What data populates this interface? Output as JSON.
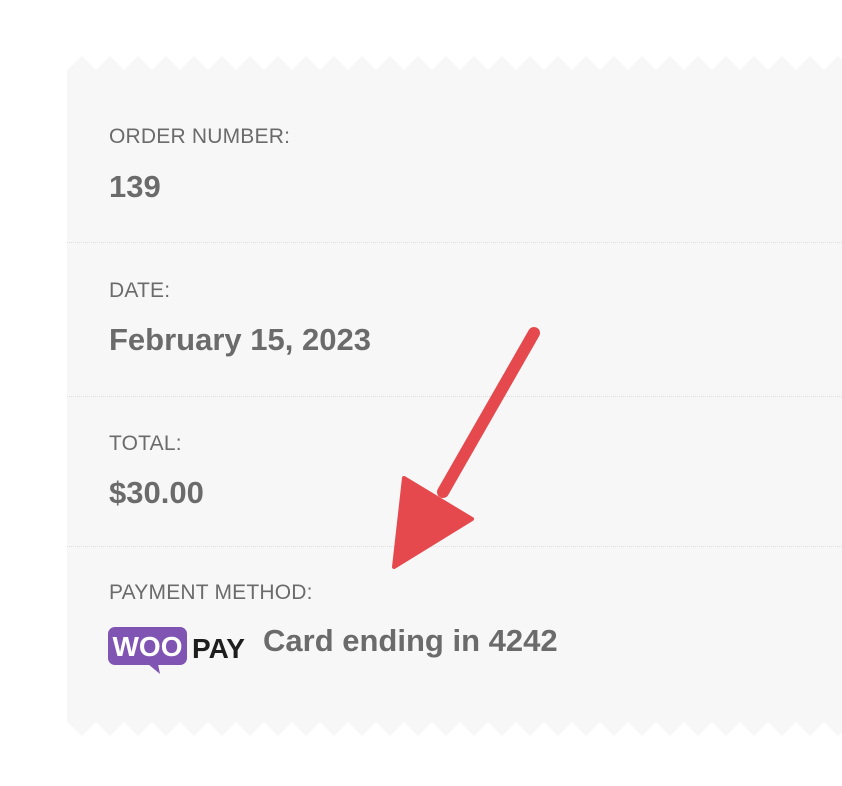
{
  "order_details": {
    "order_number": {
      "label": "ORDER NUMBER:",
      "value": "139"
    },
    "date": {
      "label": "DATE:",
      "value": "February 15, 2023"
    },
    "total": {
      "label": "TOTAL:",
      "value": "$30.00"
    },
    "payment_method": {
      "label": "PAYMENT METHOD:",
      "logo_text_woo": "WOO",
      "logo_text_pay": "PAY",
      "value": "Card ending in 4242"
    }
  },
  "colors": {
    "background": "#f7f7f7",
    "text": "#6b6b6b",
    "woo_purple": "#7f54b3",
    "arrow": "#e5484d"
  }
}
